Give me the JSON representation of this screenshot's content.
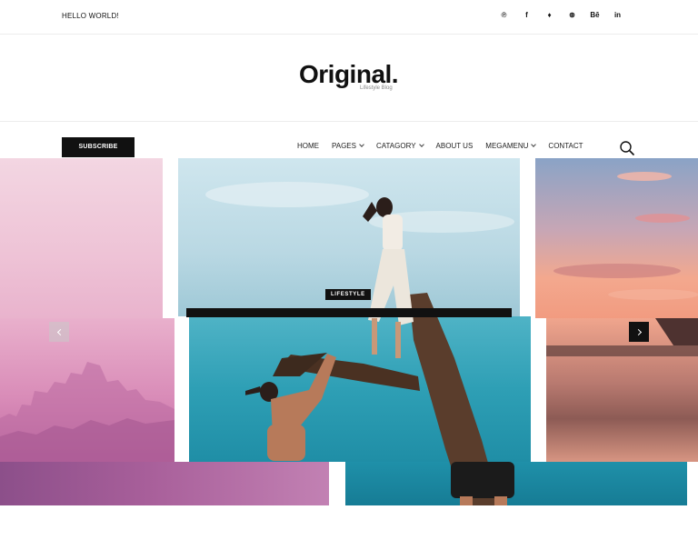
{
  "topbar": {
    "greeting": "HELLO WORLD!",
    "social": [
      {
        "icon": "pinterest-icon",
        "glyph": "℗"
      },
      {
        "icon": "facebook-icon",
        "glyph": "f"
      },
      {
        "icon": "twitter-icon",
        "glyph": "♦"
      },
      {
        "icon": "dribbble-icon",
        "glyph": "⊛"
      },
      {
        "icon": "behance-icon",
        "glyph": "Bē"
      },
      {
        "icon": "linkedin-icon",
        "glyph": "in"
      }
    ]
  },
  "brand": {
    "logo": "Original.",
    "tagline": "Lifestyle Blog"
  },
  "nav": {
    "subscribe_label": "SUBSCRIBE",
    "items": [
      {
        "label": "HOME",
        "dropdown": false
      },
      {
        "label": "PAGES",
        "dropdown": true
      },
      {
        "label": "CATAGORY",
        "dropdown": true
      },
      {
        "label": "ABOUT US",
        "dropdown": false
      },
      {
        "label": "MEGAMENU",
        "dropdown": true
      },
      {
        "label": "CONTACT",
        "dropdown": false
      }
    ],
    "search_icon": "search-icon"
  },
  "slider": {
    "badge": "LIFESTYLE",
    "prev_icon": "chevron-left-icon",
    "next_icon": "chevron-right-icon",
    "colors": {
      "dark": "#111111",
      "pink": "#e9b3cd",
      "sea": "#2e9fb5",
      "sunset": "#f29b80"
    }
  }
}
